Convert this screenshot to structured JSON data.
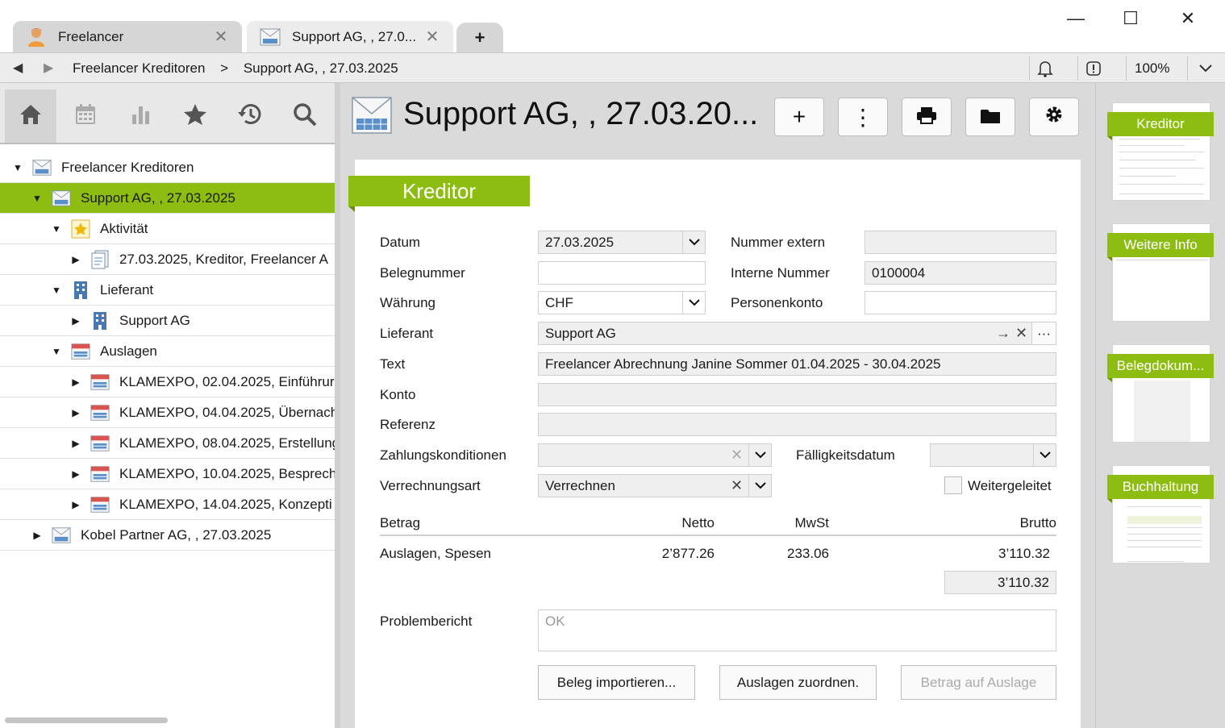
{
  "tabs": [
    {
      "label": "Freelancer",
      "icon": "person-icon"
    },
    {
      "label": "Support AG, , 27.0...",
      "icon": "invoice-icon"
    }
  ],
  "tab_add": "+",
  "window": {
    "minimize": "—",
    "maximize": "☐",
    "close": "✕"
  },
  "breadcrumb": [
    "Freelancer Kreditoren",
    ">",
    "Support AG, , 27.03.2025"
  ],
  "zoom": "100%",
  "tree": [
    {
      "label": "Freelancer Kreditoren",
      "icon": "envelope-icon",
      "tw": "▼"
    },
    {
      "label": "Support AG, , 27.03.2025",
      "icon": "envelope-icon",
      "tw": "▼"
    },
    {
      "label": "Aktivität",
      "icon": "star-icon",
      "tw": "▼"
    },
    {
      "label": "27.03.2025, Kreditor, Freelancer A",
      "icon": "document-icon",
      "tw": "▶"
    },
    {
      "label": "Lieferant",
      "icon": "building-icon",
      "tw": "▼"
    },
    {
      "label": "Support AG",
      "icon": "building-icon",
      "tw": "▶"
    },
    {
      "label": "Auslagen",
      "icon": "expense-icon",
      "tw": "▼"
    },
    {
      "label": "KLAMEXPO, 02.04.2025, Einführur",
      "icon": "expense-icon",
      "tw": "▶"
    },
    {
      "label": "KLAMEXPO, 04.04.2025, Übernach",
      "icon": "expense-icon",
      "tw": "▶"
    },
    {
      "label": "KLAMEXPO, 08.04.2025, Erstellung",
      "icon": "expense-icon",
      "tw": "▶"
    },
    {
      "label": "KLAMEXPO, 10.04.2025, Besprech",
      "icon": "expense-icon",
      "tw": "▶"
    },
    {
      "label": "KLAMEXPO, 14.04.2025, Konzepti",
      "icon": "expense-icon",
      "tw": "▶"
    },
    {
      "label": "Kobel Partner AG, , 27.03.2025",
      "icon": "envelope-icon",
      "tw": "▶"
    }
  ],
  "record_title": "Support AG, , 27.03.20...",
  "toolbar": {
    "add": "+",
    "more": "⋮"
  },
  "section_title": "Kreditor",
  "form": {
    "datum_label": "Datum",
    "datum_value": "27.03.2025",
    "nummer_extern_label": "Nummer extern",
    "nummer_extern_value": "",
    "belegnummer_label": "Belegnummer",
    "belegnummer_value": "",
    "interne_nummer_label": "Interne Nummer",
    "interne_nummer_value": "0100004",
    "waehrung_label": "Währung",
    "waehrung_value": "CHF",
    "personenkonto_label": "Personenkonto",
    "personenkonto_value": "",
    "lieferant_label": "Lieferant",
    "lieferant_value": "Support AG",
    "text_label": "Text",
    "text_value": "Freelancer Abrechnung Janine Sommer 01.04.2025 - 30.04.2025",
    "konto_label": "Konto",
    "konto_value": "",
    "referenz_label": "Referenz",
    "referenz_value": "",
    "zahlungskonditionen_label": "Zahlungskonditionen",
    "zahlungskonditionen_value": "",
    "faelligkeitsdatum_label": "Fälligkeitsdatum",
    "faelligkeitsdatum_value": "",
    "verrechnungsart_label": "Verrechnungsart",
    "verrechnungsart_value": "Verrechnen",
    "weitergeleitet_label": "Weitergeleitet"
  },
  "amounts": {
    "header": {
      "betrag": "Betrag",
      "netto": "Netto",
      "mwst": "MwSt",
      "brutto": "Brutto"
    },
    "row": {
      "label": "Auslagen, Spesen",
      "netto": "2’877.26",
      "mwst": "233.06",
      "brutto": "3’110.32"
    },
    "total": "3’110.32"
  },
  "problembericht_label": "Problembericht",
  "problembericht_value": "OK",
  "buttons": {
    "import": "Beleg importieren...",
    "assign": "Auslagen zuordnen.",
    "transfer": "Betrag auf Auslage"
  },
  "side_tabs": [
    "Kreditor",
    "Weitere Info",
    "Belegdokum...",
    "Buchhaltung"
  ],
  "colors": {
    "accent": "#8dbd10",
    "panel": "#dadada"
  }
}
